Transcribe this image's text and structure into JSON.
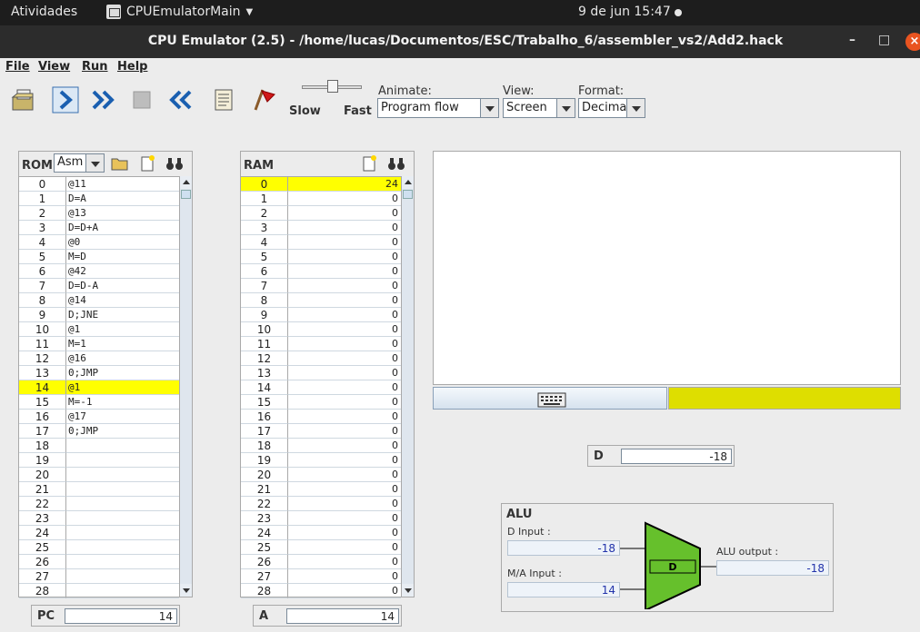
{
  "system": {
    "activities": "Atividades",
    "app_name": "CPUEmulatorMain",
    "clock": "9 de jun  15:47"
  },
  "window": {
    "title": "CPU Emulator (2.5) - /home/lucas/Documentos/ESC/Trabalho_6/assembler_vs2/Add2.hack",
    "minimize": "–",
    "maximize": "□",
    "close": "×"
  },
  "menu": {
    "file": "File",
    "view": "View",
    "run": "Run",
    "help": "Help"
  },
  "toolbar": {
    "slow": "Slow",
    "fast": "Fast",
    "animate_label": "Animate:",
    "animate_value": "Program flow",
    "view_label": "View:",
    "view_value": "Screen",
    "format_label": "Format:",
    "format_value": "Decimal"
  },
  "rom": {
    "title": "ROM",
    "mode": "Asm",
    "rows": [
      {
        "addr": "0",
        "code": "@11"
      },
      {
        "addr": "1",
        "code": "D=A"
      },
      {
        "addr": "2",
        "code": "@13"
      },
      {
        "addr": "3",
        "code": "D=D+A"
      },
      {
        "addr": "4",
        "code": "@0"
      },
      {
        "addr": "5",
        "code": "M=D"
      },
      {
        "addr": "6",
        "code": "@42"
      },
      {
        "addr": "7",
        "code": "D=D-A"
      },
      {
        "addr": "8",
        "code": "@14"
      },
      {
        "addr": "9",
        "code": "D;JNE"
      },
      {
        "addr": "10",
        "code": "@1"
      },
      {
        "addr": "11",
        "code": "M=1"
      },
      {
        "addr": "12",
        "code": "@16"
      },
      {
        "addr": "13",
        "code": "0;JMP"
      },
      {
        "addr": "14",
        "code": "@1"
      },
      {
        "addr": "15",
        "code": "M=-1"
      },
      {
        "addr": "16",
        "code": "@17"
      },
      {
        "addr": "17",
        "code": "0;JMP"
      },
      {
        "addr": "18",
        "code": ""
      },
      {
        "addr": "19",
        "code": ""
      },
      {
        "addr": "20",
        "code": ""
      },
      {
        "addr": "21",
        "code": ""
      },
      {
        "addr": "22",
        "code": ""
      },
      {
        "addr": "23",
        "code": ""
      },
      {
        "addr": "24",
        "code": ""
      },
      {
        "addr": "25",
        "code": ""
      },
      {
        "addr": "26",
        "code": ""
      },
      {
        "addr": "27",
        "code": ""
      },
      {
        "addr": "28",
        "code": ""
      }
    ],
    "highlight_index": 14
  },
  "ram": {
    "title": "RAM",
    "rows": [
      {
        "addr": "0",
        "val": "24"
      },
      {
        "addr": "1",
        "val": "0"
      },
      {
        "addr": "2",
        "val": "0"
      },
      {
        "addr": "3",
        "val": "0"
      },
      {
        "addr": "4",
        "val": "0"
      },
      {
        "addr": "5",
        "val": "0"
      },
      {
        "addr": "6",
        "val": "0"
      },
      {
        "addr": "7",
        "val": "0"
      },
      {
        "addr": "8",
        "val": "0"
      },
      {
        "addr": "9",
        "val": "0"
      },
      {
        "addr": "10",
        "val": "0"
      },
      {
        "addr": "11",
        "val": "0"
      },
      {
        "addr": "12",
        "val": "0"
      },
      {
        "addr": "13",
        "val": "0"
      },
      {
        "addr": "14",
        "val": "0"
      },
      {
        "addr": "15",
        "val": "0"
      },
      {
        "addr": "16",
        "val": "0"
      },
      {
        "addr": "17",
        "val": "0"
      },
      {
        "addr": "18",
        "val": "0"
      },
      {
        "addr": "19",
        "val": "0"
      },
      {
        "addr": "20",
        "val": "0"
      },
      {
        "addr": "21",
        "val": "0"
      },
      {
        "addr": "22",
        "val": "0"
      },
      {
        "addr": "23",
        "val": "0"
      },
      {
        "addr": "24",
        "val": "0"
      },
      {
        "addr": "25",
        "val": "0"
      },
      {
        "addr": "26",
        "val": "0"
      },
      {
        "addr": "27",
        "val": "0"
      },
      {
        "addr": "28",
        "val": "0"
      }
    ],
    "highlight_index": 0
  },
  "registers": {
    "pc_label": "PC",
    "pc_value": "14",
    "a_label": "A",
    "a_value": "14",
    "d_label": "D",
    "d_value": "-18"
  },
  "alu": {
    "title": "ALU",
    "d_input_label": "D Input :",
    "d_input_value": "-18",
    "ma_input_label": "M/A Input :",
    "ma_input_value": "14",
    "output_label": "ALU output :",
    "output_value": "-18",
    "unit_label": "D"
  },
  "colors": {
    "highlight": "#ffff00",
    "keyboard_bar": "#dede00",
    "alu_green": "#66c02c"
  }
}
